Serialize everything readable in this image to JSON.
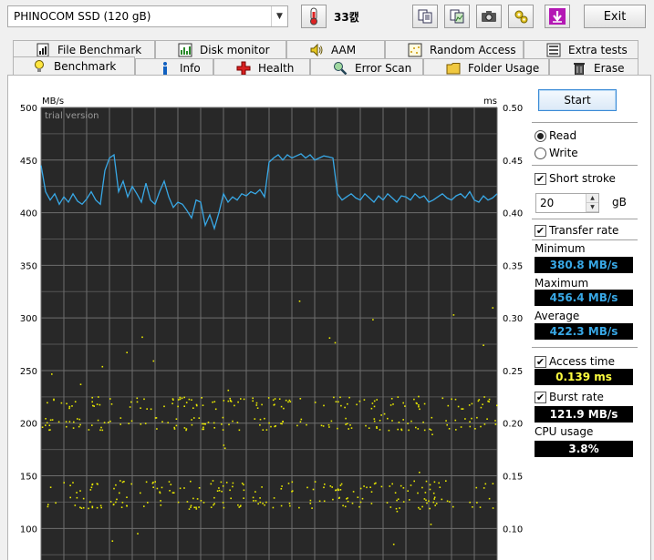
{
  "drive": {
    "name": "PHINOCOM SSD (120 gB)"
  },
  "temperature": "33캜",
  "toolbar": {
    "icons": [
      "copy-text-icon",
      "copy-image-icon",
      "screenshot-camera-icon",
      "gear-options-icon",
      "save-arrow-icon"
    ],
    "exit_label": "Exit"
  },
  "tabs_top": [
    {
      "label": "File Benchmark",
      "icon": "file-benchmark-icon"
    },
    {
      "label": "Disk monitor",
      "icon": "disk-monitor-icon"
    },
    {
      "label": "AAM",
      "icon": "speaker-icon"
    },
    {
      "label": "Random Access",
      "icon": "random-access-icon"
    },
    {
      "label": "Extra tests",
      "icon": "extra-tests-icon"
    }
  ],
  "tabs_bottom": [
    {
      "label": "Benchmark",
      "icon": "lightbulb-icon",
      "active": true
    },
    {
      "label": "Info",
      "icon": "info-icon"
    },
    {
      "label": "Health",
      "icon": "health-cross-icon"
    },
    {
      "label": "Error Scan",
      "icon": "magnifier-icon"
    },
    {
      "label": "Folder Usage",
      "icon": "folder-icon"
    },
    {
      "label": "Erase",
      "icon": "trash-icon"
    }
  ],
  "chart_data": {
    "type": "line",
    "watermark": "trial version",
    "left_unit": "MB/s",
    "right_unit": "ms",
    "left_ticks": [
      "500",
      "450",
      "400",
      "350",
      "300",
      "250",
      "200",
      "150",
      "100"
    ],
    "right_ticks": [
      "0.50",
      "0.45",
      "0.40",
      "0.35",
      "0.30",
      "0.25",
      "0.20",
      "0.15",
      "0.10"
    ],
    "ylim": [
      70,
      500
    ],
    "xlim": [
      0,
      100
    ],
    "grid": true,
    "background": "#282828",
    "series": [
      {
        "kind": "transfer-rate-mbps",
        "color": "#38a8e6",
        "x": [
          0,
          1,
          2,
          3,
          4,
          5,
          6,
          7,
          8,
          9,
          10,
          11,
          12,
          13,
          14,
          15,
          16,
          17,
          18,
          19,
          20,
          21,
          22,
          23,
          24,
          25,
          26,
          27,
          28,
          29,
          30,
          31,
          32,
          33,
          34,
          35,
          36,
          37,
          38,
          39,
          40,
          41,
          42,
          43,
          44,
          45,
          46,
          47,
          48,
          49,
          50,
          51,
          52,
          53,
          54,
          55,
          56,
          57,
          58,
          59,
          60,
          61,
          62,
          63,
          64,
          65,
          66,
          67,
          68,
          69,
          70,
          71,
          72,
          73,
          74,
          75,
          76,
          77,
          78,
          79,
          80,
          81,
          82,
          83,
          84,
          85,
          86,
          87,
          88,
          89,
          90,
          91,
          92,
          93,
          94,
          95,
          96,
          97,
          98,
          99,
          100
        ],
        "values": [
          445,
          420,
          412,
          418,
          408,
          415,
          410,
          418,
          411,
          408,
          413,
          420,
          412,
          408,
          440,
          452,
          455,
          420,
          430,
          415,
          425,
          418,
          410,
          428,
          412,
          408,
          420,
          430,
          415,
          405,
          410,
          408,
          402,
          395,
          412,
          410,
          388,
          398,
          385,
          400,
          418,
          410,
          415,
          412,
          418,
          416,
          420,
          418,
          422,
          415,
          448,
          452,
          455,
          450,
          455,
          452,
          454,
          456,
          452,
          455,
          450,
          452,
          454,
          453,
          452,
          418,
          412,
          415,
          418,
          414,
          412,
          418,
          414,
          410,
          416,
          412,
          418,
          414,
          410,
          416,
          415,
          412,
          418,
          414,
          416,
          410,
          412,
          415,
          418,
          414,
          412,
          416,
          418,
          414,
          420,
          412,
          410,
          416,
          412,
          414,
          418
        ]
      }
    ],
    "access_time_scatter": {
      "color": "#e8e800",
      "unit": "ms",
      "bands_ms": [
        0.125,
        0.14,
        0.2,
        0.22
      ]
    }
  },
  "controls": {
    "start_label": "Start",
    "read_label": "Read",
    "write_label": "Write",
    "read_selected": true,
    "short_stroke_label": "Short stroke",
    "short_stroke_checked": true,
    "stroke_value": "20",
    "stroke_unit": "gB",
    "transfer_rate_label": "Transfer rate",
    "transfer_rate_checked": true,
    "access_time_label": "Access time",
    "access_time_checked": true,
    "burst_rate_label": "Burst rate",
    "burst_rate_checked": true,
    "cpu_label": "CPU usage"
  },
  "results": {
    "minimum_label": "Minimum",
    "minimum_value": "380.8 MB/s",
    "maximum_label": "Maximum",
    "maximum_value": "456.4 MB/s",
    "average_label": "Average",
    "average_value": "422.3 MB/s",
    "access_time_value": "0.139 ms",
    "burst_rate_value": "121.9 MB/s",
    "cpu_value": "3.8%"
  },
  "colors": {
    "transfer": "#38a8e6",
    "access": "#ffff40",
    "cpu": "#ffffff",
    "burst": "#ffffff"
  }
}
